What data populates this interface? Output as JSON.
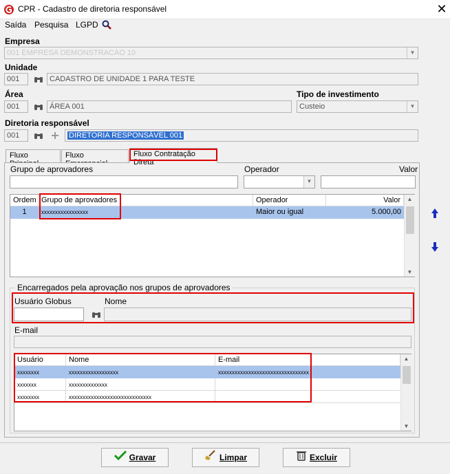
{
  "window": {
    "title": "CPR - Cadastro de diretoria responsável",
    "close": "✕"
  },
  "menu": {
    "saida": "Saída",
    "pesquisa": "Pesquisa",
    "lgpd": "LGPD"
  },
  "form": {
    "empresa": {
      "label": "Empresa",
      "value": "001 EMPRESA DEMONSTRACAO 10"
    },
    "unidade": {
      "label": "Unidade",
      "code": "001",
      "name": "CADASTRO DE UNIDADE 1 PARA TESTE"
    },
    "area": {
      "label": "Área",
      "code": "001",
      "name": "ÁREA 001"
    },
    "tipo_investimento": {
      "label": "Tipo de investimento",
      "value": "Custeio"
    },
    "diretoria": {
      "label": "Diretoria responsável",
      "code": "001",
      "name": "DIRETORIA RESPONSÁVEL 001"
    }
  },
  "tabs": [
    "Fluxo Principal",
    "Fluxo Emergencial",
    "Fluxo Contratação Direta"
  ],
  "filters": {
    "grupo_label": "Grupo de aprovadores",
    "operador_label": "Operador",
    "valor_label": "Valor"
  },
  "grid1": {
    "headers": [
      "Ordem",
      "Grupo de aprovadores",
      "Operador",
      "Valor"
    ],
    "rows": [
      {
        "ordem": "1",
        "grupo": "xxxxxxxxxxxxxxxxx",
        "operador": "Maior ou igual",
        "valor": "5.000,00"
      }
    ]
  },
  "encarregados": {
    "legend": "Encarregados pela aprovação nos grupos de aprovadores",
    "usuario_label": "Usuário Globus",
    "nome_label": "Nome",
    "email_label": "E-mail"
  },
  "grid2": {
    "headers": [
      "Usuário",
      "Nome",
      "E-mail"
    ],
    "rows": [
      {
        "usuario": "xxxxxxxx",
        "nome": "xxxxxxxxxxxxxxxxxx",
        "email": "xxxxxxxxxxxxxxxxxxxxxxxxxxxxxxxxx"
      },
      {
        "usuario": "xxxxxxx",
        "nome": "xxxxxxxxxxxxxx",
        "email": ""
      },
      {
        "usuario": "xxxxxxxx",
        "nome": "xxxxxxxxxxxxxxxxxxxxxxxxxxxxxx",
        "email": ""
      }
    ]
  },
  "buttons": {
    "gravar": "Gravar",
    "limpar": "Limpar",
    "excluir": "Excluir"
  },
  "colors": {
    "selection": "#a8c4ec",
    "highlight_box": "#e00000",
    "accent": "#3070d0"
  }
}
